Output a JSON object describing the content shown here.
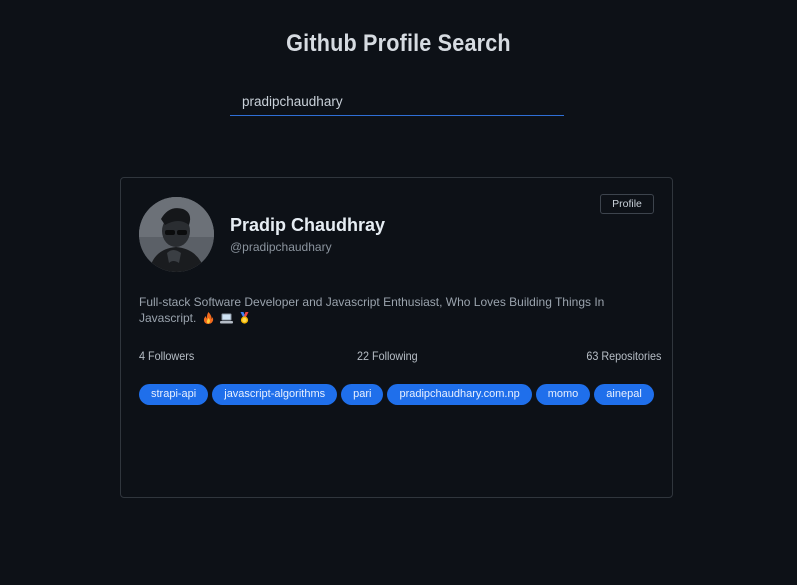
{
  "header": {
    "title": "Github Profile Search"
  },
  "search": {
    "value": "pradipchaudhary"
  },
  "profile": {
    "name": "Pradip Chaudhray",
    "handle": "@pradipchaudhary",
    "profile_button_label": "Profile",
    "bio": "Full-stack Software Developer and Javascript Enthusiast, Who Loves Building Things In Javascript.",
    "bio_emojis": [
      "fire-emoji",
      "laptop-emoji",
      "medal-emoji"
    ],
    "stats": {
      "followers": "4 Followers",
      "following": "22 Following",
      "repositories": "63 Repositories"
    },
    "repos": [
      "strapi-api",
      "javascript-algorithms",
      "pari",
      "pradipchaudhary.com.np",
      "momo",
      "ainepal"
    ]
  },
  "colors": {
    "background": "#0d1117",
    "accent": "#1f6feb",
    "card_border": "#30363d"
  }
}
